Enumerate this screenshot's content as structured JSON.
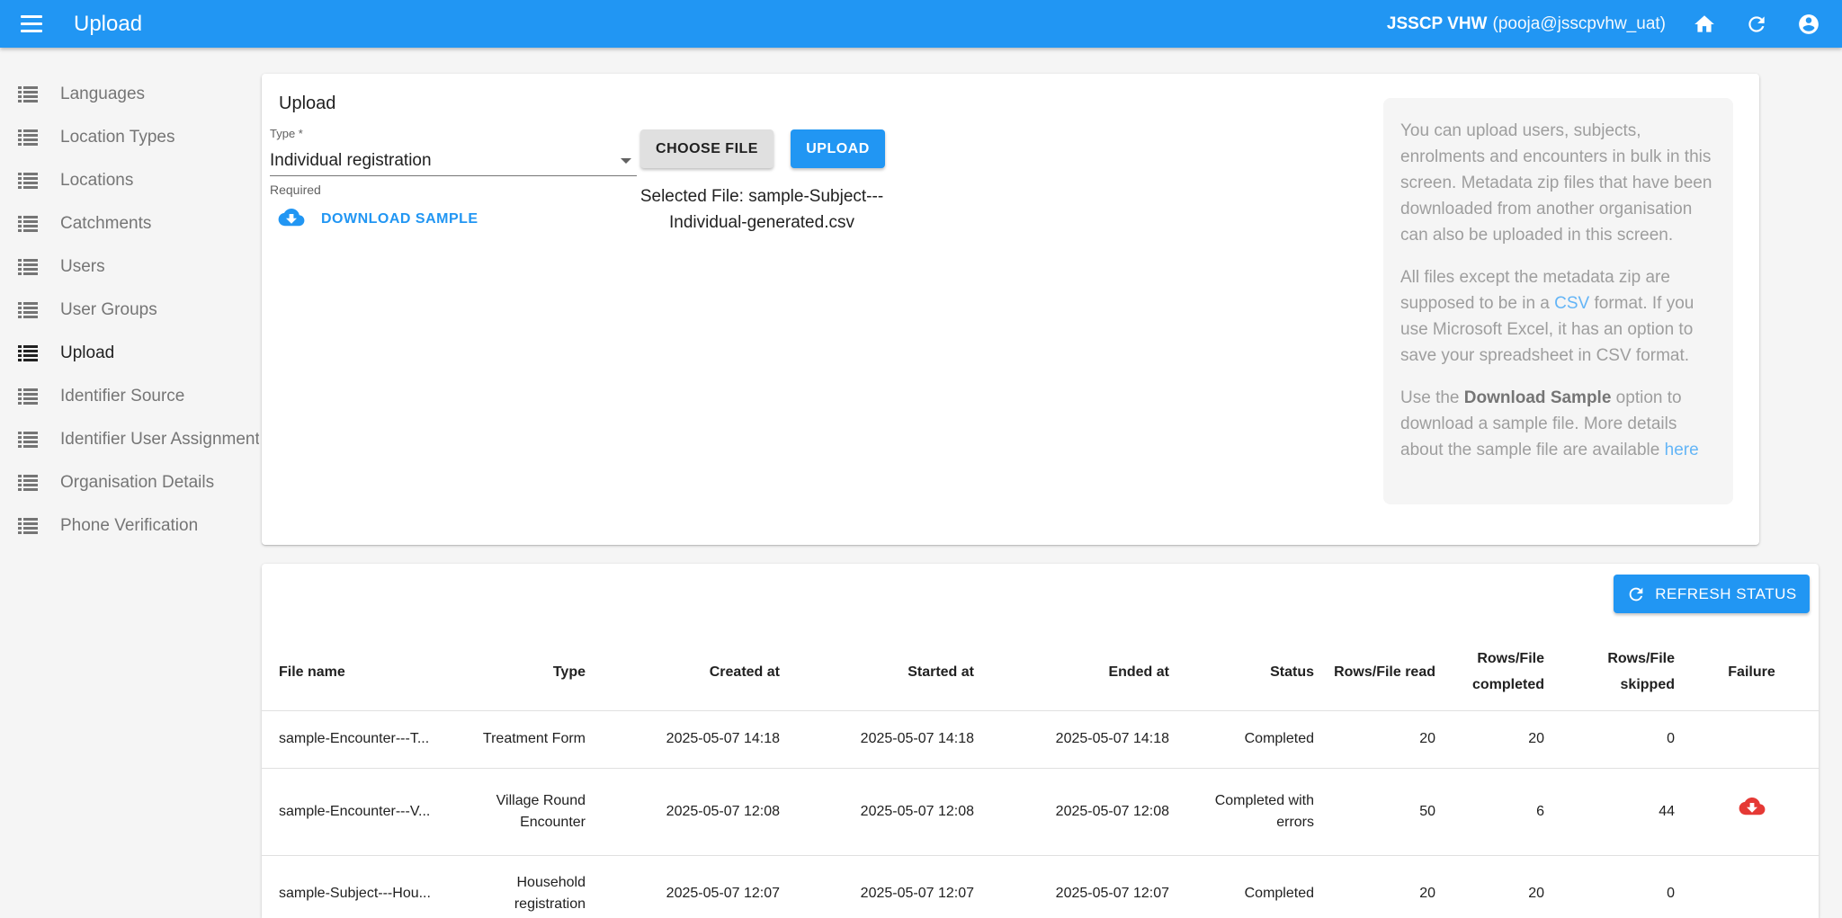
{
  "appbar": {
    "title": "Upload",
    "org": "JSSCP VHW",
    "user": "(pooja@jsscpvhw_uat)"
  },
  "sidebar": {
    "items": [
      {
        "label": "Languages"
      },
      {
        "label": "Location Types"
      },
      {
        "label": "Locations"
      },
      {
        "label": "Catchments"
      },
      {
        "label": "Users"
      },
      {
        "label": "User Groups"
      },
      {
        "label": "Upload",
        "active": true
      },
      {
        "label": "Identifier Source"
      },
      {
        "label": "Identifier User Assignment"
      },
      {
        "label": "Organisation Details"
      },
      {
        "label": "Phone Verification"
      }
    ]
  },
  "upload": {
    "title": "Upload",
    "type_label": "Type *",
    "type_value": "Individual registration",
    "required": "Required",
    "choose_file": "CHOOSE FILE",
    "upload": "UPLOAD",
    "selected_file": "Selected File: sample-Subject---Individual-generated.csv",
    "download_sample": "DOWNLOAD SAMPLE"
  },
  "info": {
    "p1": "You can upload users, subjects, enrolments and encounters in bulk in this screen. Metadata zip files that have been downloaded from another organisation can also be uploaded in this screen.",
    "p2_a": "All files except the metadata zip are supposed to be in a ",
    "p2_link": "CSV",
    "p2_b": " format. If you use Microsoft Excel, it has an option to save your spreadsheet in CSV format.",
    "p3_a": "Use the ",
    "p3_bold": "Download Sample",
    "p3_b": " option to download a sample file. More details about the sample file are available ",
    "p3_link": "here"
  },
  "status": {
    "refresh": "REFRESH STATUS",
    "columns": {
      "file_name": "File name",
      "type": "Type",
      "created_at": "Created at",
      "started_at": "Started at",
      "ended_at": "Ended at",
      "status": "Status",
      "rows_read": "Rows/File read",
      "rows_completed": "Rows/File completed",
      "rows_skipped": "Rows/File skipped",
      "failure": "Failure"
    },
    "rows": [
      {
        "file_name": "sample-Encounter---T...",
        "type": "Treatment Form",
        "created_at": "2025-05-07 14:18",
        "started_at": "2025-05-07 14:18",
        "ended_at": "2025-05-07 14:18",
        "status": "Completed",
        "read": "20",
        "completed": "20",
        "skipped": "0"
      },
      {
        "file_name": "sample-Encounter---V...",
        "type": "Village Round Encounter",
        "created_at": "2025-05-07 12:08",
        "started_at": "2025-05-07 12:08",
        "ended_at": "2025-05-07 12:08",
        "status": "Completed with errors",
        "read": "50",
        "completed": "6",
        "skipped": "44"
      },
      {
        "file_name": "sample-Subject---Hou...",
        "type": "Household registration",
        "created_at": "2025-05-07 12:07",
        "started_at": "2025-05-07 12:07",
        "ended_at": "2025-05-07 12:07",
        "status": "Completed",
        "read": "20",
        "completed": "20",
        "skipped": "0"
      }
    ]
  },
  "icons": {
    "menu": "menu-icon",
    "home": "home-icon",
    "refresh": "refresh-icon",
    "account": "account-circle-icon",
    "list": "list-icon",
    "cloud_download": "cloud-download-icon"
  },
  "colors": {
    "primary": "#2196f3",
    "error": "#e53935"
  }
}
